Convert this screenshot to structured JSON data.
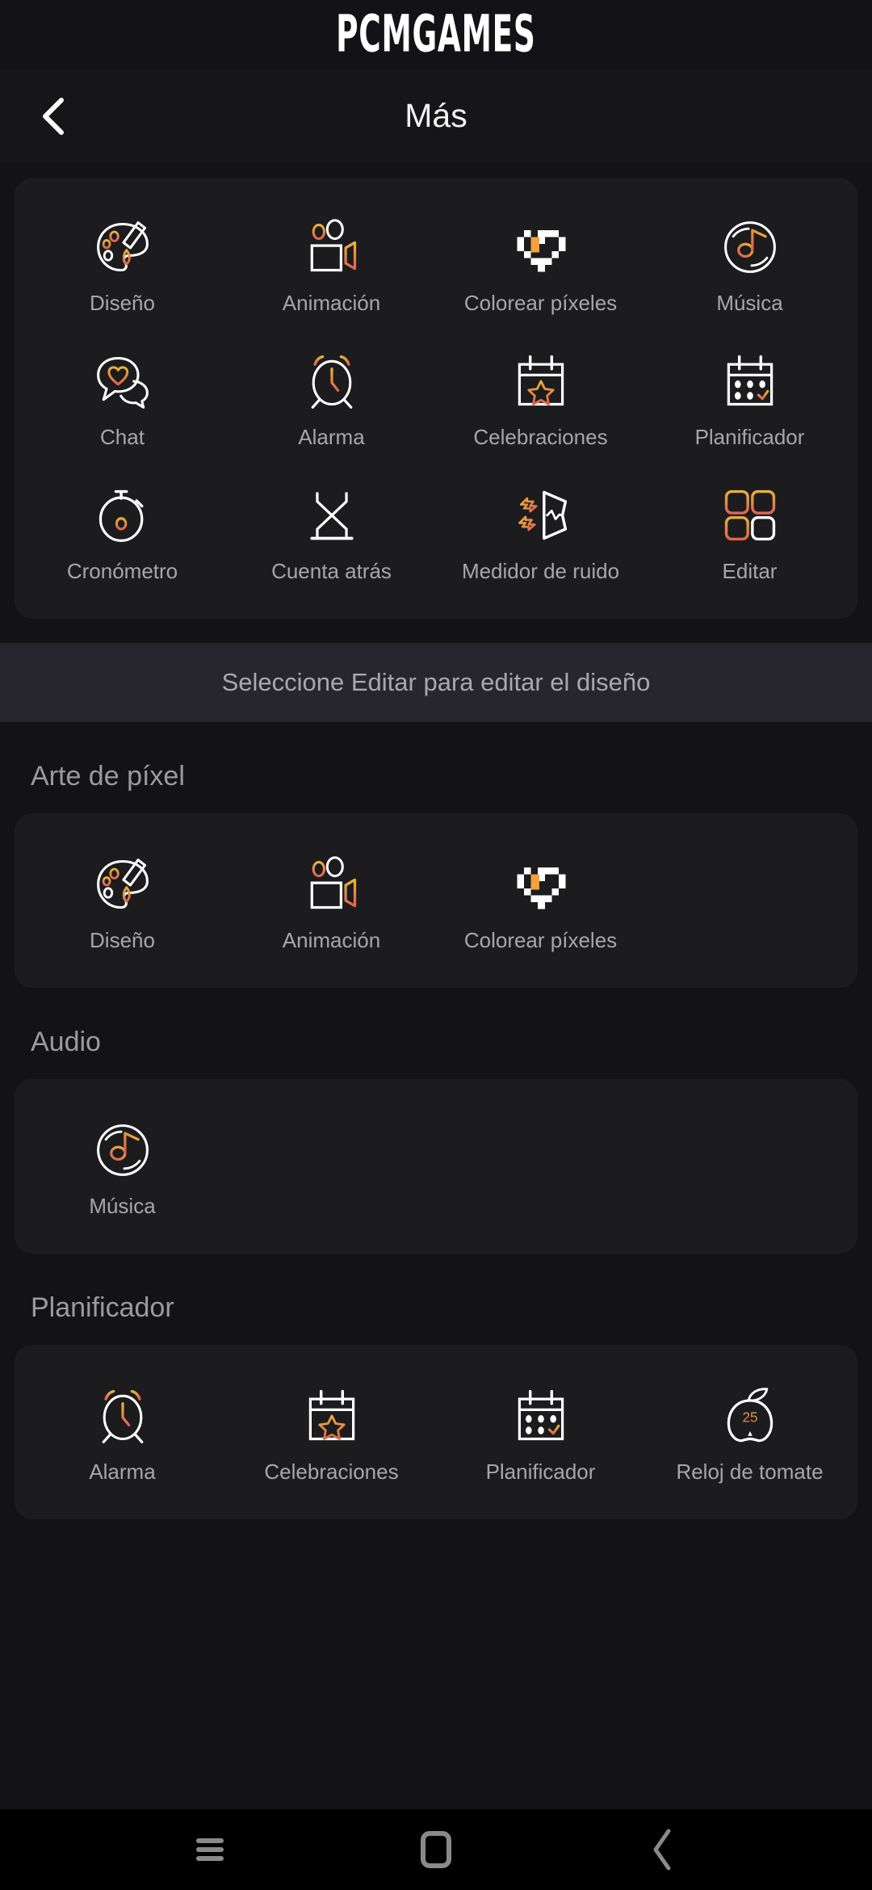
{
  "brand": {
    "name": "PCMGAMES"
  },
  "header": {
    "title": "Más",
    "back_icon": "chevron-left-icon"
  },
  "colors": {
    "page_bg": "#131315",
    "card_bg": "#1c1c1e",
    "brand_bar_bg": "#121217",
    "banner_bg": "#26262c",
    "label_text": "#a7a7a7",
    "section_text": "#9b9b9b",
    "accent_yellow": "#e8b23a",
    "accent_orange": "#ef8b3c",
    "accent_red": "#e0634f",
    "icon_stroke": "#ffffff"
  },
  "main_grid": {
    "items": [
      {
        "label": "Diseño",
        "icon": "palette-icon"
      },
      {
        "label": "Animación",
        "icon": "video-camera-icon"
      },
      {
        "label": "Colorear píxeles",
        "icon": "pixel-heart-icon"
      },
      {
        "label": "Música",
        "icon": "vinyl-note-icon"
      },
      {
        "label": "Chat",
        "icon": "chat-heart-icon"
      },
      {
        "label": "Alarma",
        "icon": "alarm-clock-icon"
      },
      {
        "label": "Celebraciones",
        "icon": "calendar-star-icon"
      },
      {
        "label": "Planificador",
        "icon": "calendar-check-icon"
      },
      {
        "label": "Cronómetro",
        "icon": "stopwatch-icon"
      },
      {
        "label": "Cuenta atrás",
        "icon": "hourglass-icon"
      },
      {
        "label": "Medidor de ruido",
        "icon": "noise-meter-icon"
      },
      {
        "label": "Editar",
        "icon": "grid-edit-icon"
      }
    ]
  },
  "hint_banner": {
    "text": "Seleccione Editar para editar el diseño"
  },
  "sections": [
    {
      "title": "Arte de píxel",
      "items": [
        {
          "label": "Diseño",
          "icon": "palette-icon"
        },
        {
          "label": "Animación",
          "icon": "video-camera-icon"
        },
        {
          "label": "Colorear píxeles",
          "icon": "pixel-heart-icon"
        }
      ]
    },
    {
      "title": "Audio",
      "items": [
        {
          "label": "Música",
          "icon": "vinyl-note-icon"
        }
      ]
    },
    {
      "title": "Planificador",
      "items": [
        {
          "label": "Alarma",
          "icon": "alarm-clock-icon"
        },
        {
          "label": "Celebraciones",
          "icon": "calendar-star-icon"
        },
        {
          "label": "Planificador",
          "icon": "calendar-check-icon"
        },
        {
          "label": "Reloj de tomate",
          "icon": "tomato-timer-icon"
        }
      ]
    }
  ],
  "navbar": {
    "recent_label": "recent-apps-icon",
    "home_label": "home-icon",
    "back_label": "back-icon"
  }
}
